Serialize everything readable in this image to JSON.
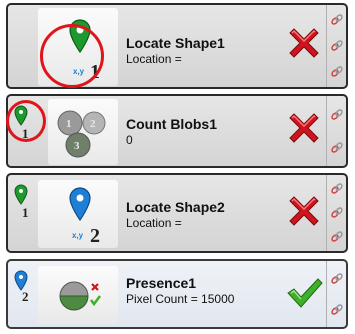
{
  "steps": [
    {
      "title": "Locate Shape1",
      "detail": "Location =",
      "tool_number": "1",
      "coord_label": "x,y",
      "status": "fail"
    },
    {
      "title": "Count Blobs1",
      "detail": "0",
      "ref_number": "1",
      "status": "fail"
    },
    {
      "title": "Locate Shape2",
      "detail": "Location =",
      "ref_number": "1",
      "tool_number": "2",
      "coord_label": "x,y",
      "status": "fail"
    },
    {
      "title": "Presence1",
      "detail": "Pixel Count = 15000",
      "ref_number": "2",
      "status": "pass"
    }
  ],
  "icons": {
    "location_pin_green": "location-pin-icon",
    "location_pin_blue": "location-pin-icon",
    "fail": "red-x-icon",
    "pass": "green-check-icon",
    "link": "chain-link-icon",
    "blobs": "blobs-icon",
    "presence": "presence-icon"
  },
  "colors": {
    "pin_green": "#1c9a2e",
    "pin_blue": "#1f7fd6",
    "fail_red": "#d0141e",
    "pass_green": "#3eb02a",
    "highlight_ring": "#e0141b",
    "link_red": "#c44"
  }
}
